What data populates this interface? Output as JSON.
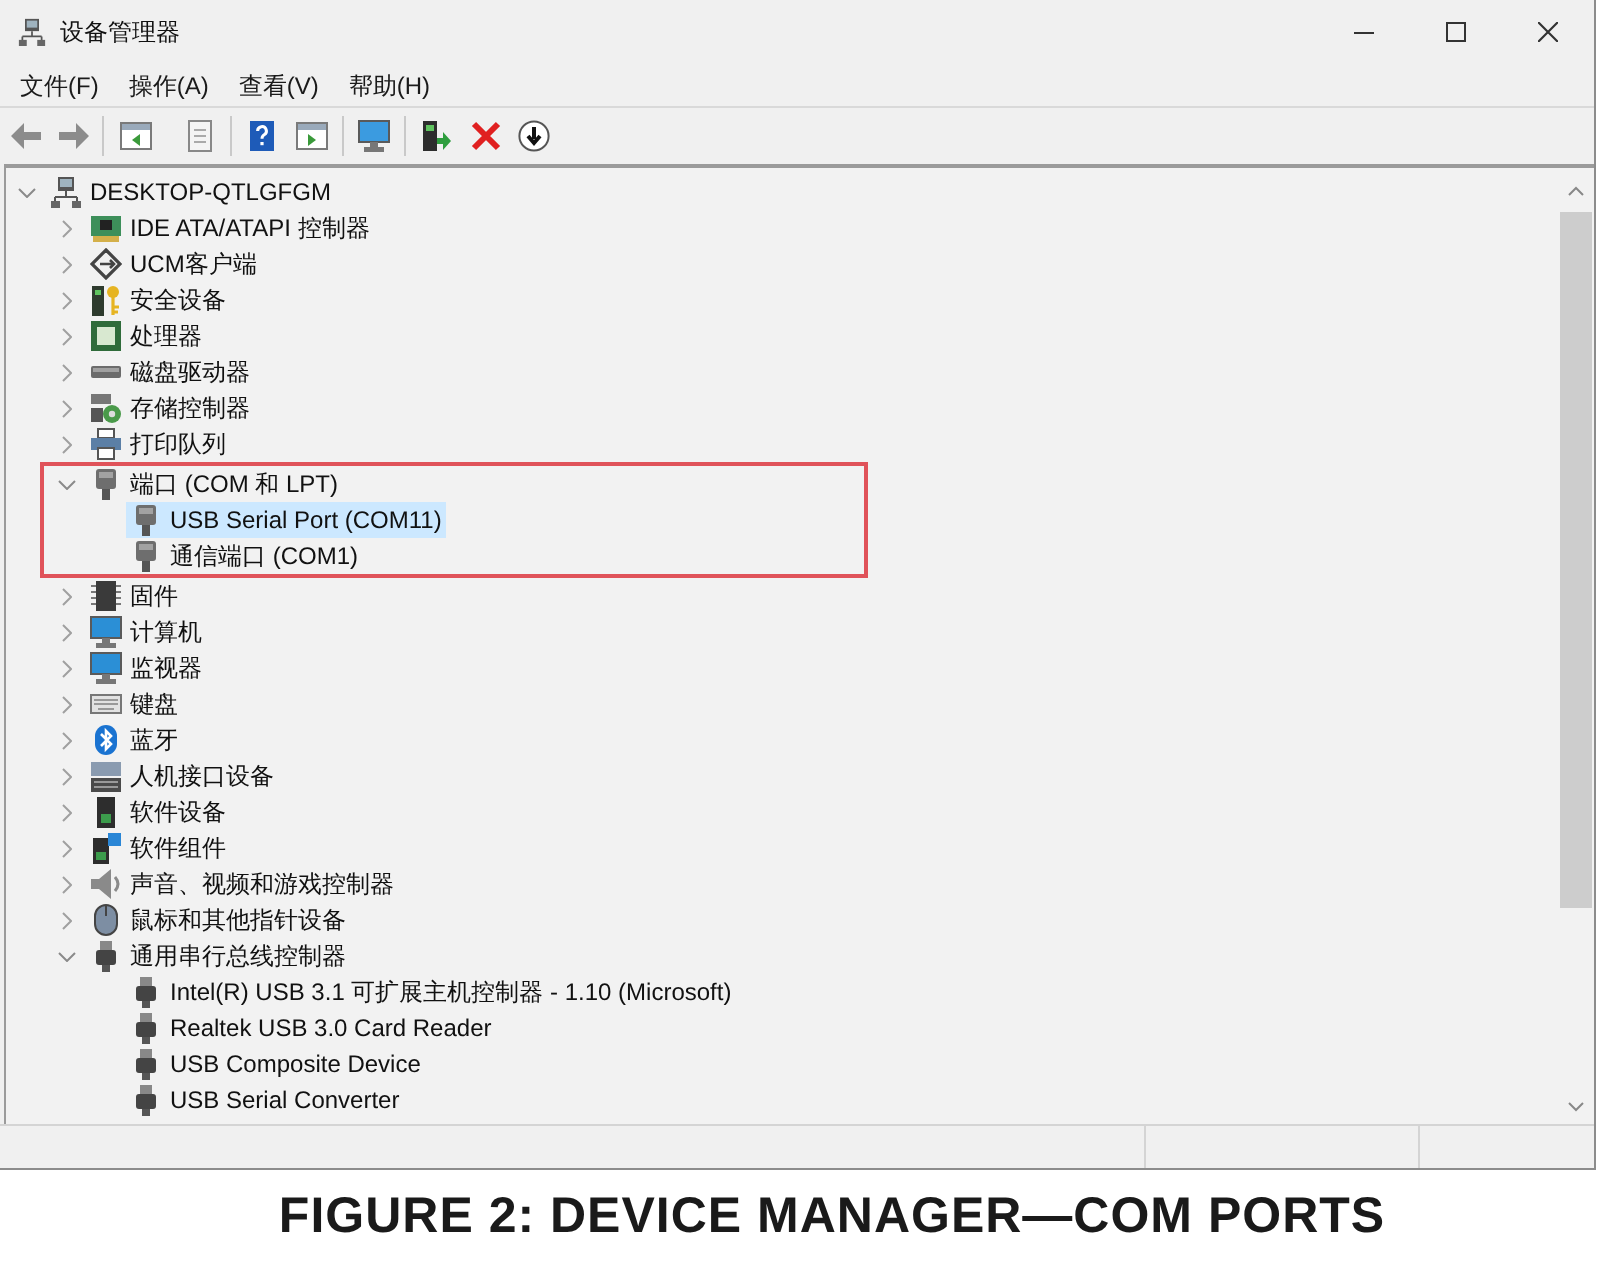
{
  "window": {
    "title": "设备管理器"
  },
  "menu": [
    "文件(F)",
    "操作(A)",
    "查看(V)",
    "帮助(H)"
  ],
  "tree": {
    "label": "DESKTOP-QTLGFGM",
    "expanded": true,
    "selected": false,
    "children": [
      {
        "label": "IDE ATA/ATAPI 控制器",
        "expanded": false,
        "selected": false,
        "highlighted": false
      },
      {
        "label": "UCM客户端",
        "expanded": false,
        "selected": false,
        "highlighted": false
      },
      {
        "label": "安全设备",
        "expanded": false,
        "selected": false,
        "highlighted": false
      },
      {
        "label": "处理器",
        "expanded": false,
        "selected": false,
        "highlighted": false
      },
      {
        "label": "磁盘驱动器",
        "expanded": false,
        "selected": false,
        "highlighted": false
      },
      {
        "label": "存储控制器",
        "expanded": false,
        "selected": false,
        "highlighted": false
      },
      {
        "label": "打印队列",
        "expanded": false,
        "selected": false,
        "highlighted": false
      },
      {
        "label": "端口 (COM 和 LPT)",
        "expanded": true,
        "selected": false,
        "highlighted": true,
        "children": [
          {
            "label": "USB Serial Port (COM11)",
            "selected": true
          },
          {
            "label": "通信端口 (COM1)",
            "selected": false
          }
        ]
      },
      {
        "label": "固件",
        "expanded": false,
        "selected": false,
        "highlighted": false
      },
      {
        "label": "计算机",
        "expanded": false,
        "selected": false,
        "highlighted": false
      },
      {
        "label": "监视器",
        "expanded": false,
        "selected": false,
        "highlighted": false
      },
      {
        "label": "键盘",
        "expanded": false,
        "selected": false,
        "highlighted": false
      },
      {
        "label": "蓝牙",
        "expanded": false,
        "selected": false,
        "highlighted": false
      },
      {
        "label": "人机接口设备",
        "expanded": false,
        "selected": false,
        "highlighted": false
      },
      {
        "label": "软件设备",
        "expanded": false,
        "selected": false,
        "highlighted": false
      },
      {
        "label": "软件组件",
        "expanded": false,
        "selected": false,
        "highlighted": false
      },
      {
        "label": "声音、视频和游戏控制器",
        "expanded": false,
        "selected": false,
        "highlighted": false
      },
      {
        "label": "鼠标和其他指针设备",
        "expanded": false,
        "selected": false,
        "highlighted": false
      },
      {
        "label": "通用串行总线控制器",
        "expanded": true,
        "selected": false,
        "highlighted": false,
        "children": [
          {
            "label": "Intel(R) USB 3.1 可扩展主机控制器 - 1.10 (Microsoft)",
            "selected": false
          },
          {
            "label": "Realtek USB 3.0 Card Reader",
            "selected": false
          },
          {
            "label": "USB Composite Device",
            "selected": false
          },
          {
            "label": "USB Serial Converter",
            "selected": false
          }
        ]
      }
    ]
  },
  "caption": "FIGURE 2: DEVICE MANAGER—COM PORTS"
}
